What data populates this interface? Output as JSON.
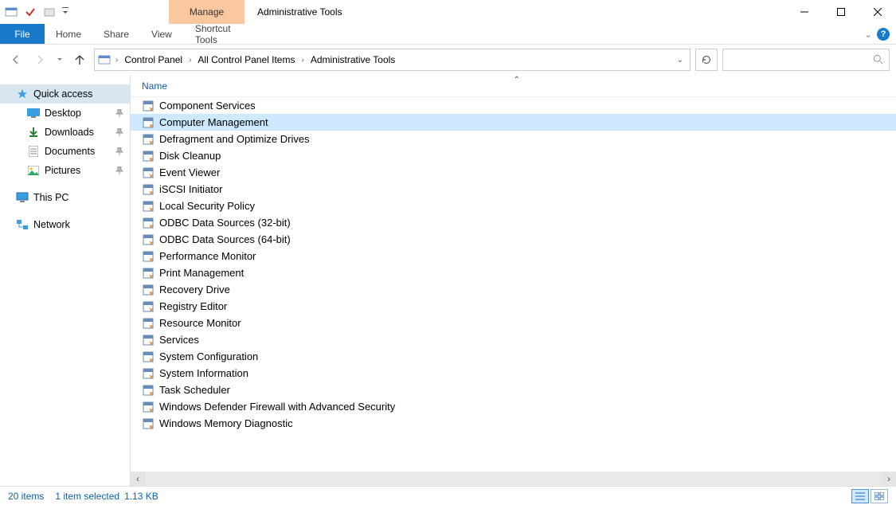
{
  "window": {
    "context_tab": "Manage",
    "title": "Administrative Tools"
  },
  "ribbon": {
    "file": "File",
    "tabs": [
      "Home",
      "Share",
      "View"
    ],
    "context_tab": "Shortcut Tools"
  },
  "breadcrumb": [
    "Control Panel",
    "All Control Panel Items",
    "Administrative Tools"
  ],
  "sidebar": {
    "quick_access": "Quick access",
    "quick_items": [
      {
        "label": "Desktop",
        "icon": "desktop",
        "pinned": true
      },
      {
        "label": "Downloads",
        "icon": "downloads",
        "pinned": true
      },
      {
        "label": "Documents",
        "icon": "documents",
        "pinned": true
      },
      {
        "label": "Pictures",
        "icon": "pictures",
        "pinned": true
      }
    ],
    "this_pc": "This PC",
    "network": "Network"
  },
  "columns": {
    "name": "Name"
  },
  "files": [
    {
      "name": "Component Services",
      "selected": false
    },
    {
      "name": "Computer Management",
      "selected": true
    },
    {
      "name": "Defragment and Optimize Drives",
      "selected": false
    },
    {
      "name": "Disk Cleanup",
      "selected": false
    },
    {
      "name": "Event Viewer",
      "selected": false
    },
    {
      "name": "iSCSI Initiator",
      "selected": false
    },
    {
      "name": "Local Security Policy",
      "selected": false
    },
    {
      "name": "ODBC Data Sources (32-bit)",
      "selected": false
    },
    {
      "name": "ODBC Data Sources (64-bit)",
      "selected": false
    },
    {
      "name": "Performance Monitor",
      "selected": false
    },
    {
      "name": "Print Management",
      "selected": false
    },
    {
      "name": "Recovery Drive",
      "selected": false
    },
    {
      "name": "Registry Editor",
      "selected": false
    },
    {
      "name": "Resource Monitor",
      "selected": false
    },
    {
      "name": "Services",
      "selected": false
    },
    {
      "name": "System Configuration",
      "selected": false
    },
    {
      "name": "System Information",
      "selected": false
    },
    {
      "name": "Task Scheduler",
      "selected": false
    },
    {
      "name": "Windows Defender Firewall with Advanced Security",
      "selected": false
    },
    {
      "name": "Windows Memory Diagnostic",
      "selected": false
    }
  ],
  "status": {
    "count": "20 items",
    "selection": "1 item selected",
    "size": "1.13 KB"
  }
}
